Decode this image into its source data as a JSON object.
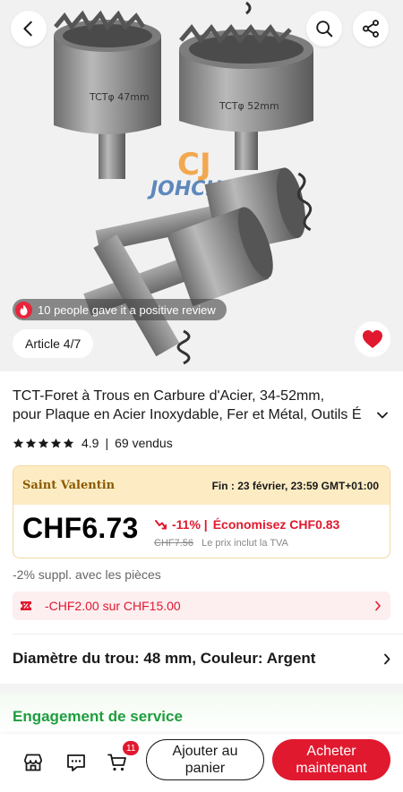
{
  "gallery": {
    "review_badge": "10 people gave it a positive review",
    "article_counter": "Article 4/7",
    "brand_watermark": "JOHCH",
    "engraving_left": "TCTφ 47mm",
    "engraving_right": "TCTφ 52mm"
  },
  "product": {
    "title_line1": "TCT-Foret à Trous en Carbure d'Acier, 34-52mm,",
    "title_line2": "pour Plaque en Acier Inoxydable, Fer et Métal, Outils É",
    "rating": "4.9",
    "sold": "69 vendus",
    "stars_filled": 5
  },
  "promo": {
    "name": "Saint Valentin",
    "ends": "Fin :  23 février, 23:59 GMT+01:00",
    "price": "CHF6.73",
    "discount": "-11% |",
    "savings": "Économisez CHF0.83",
    "old_price": "CHF7.56",
    "vat_note": "Le prix inclut la TVA"
  },
  "extra_note": "-2% suppl. avec les pièces",
  "coupon": {
    "text": "-CHF2.00 sur CHF15.00"
  },
  "spec": {
    "text": "Diamètre du trou: 48 mm, Couleur: Argent"
  },
  "service": {
    "title": "Engagement de service"
  },
  "bottom_bar": {
    "cart_count": "11",
    "add_to_cart_line1": "Ajouter au",
    "add_to_cart_line2": "panier",
    "buy_now_line1": "Acheter",
    "buy_now_line2": "maintenant"
  },
  "colors": {
    "accent": "#e0192f",
    "promo_header": "#fdecc3",
    "service_green": "#1e9e3e"
  }
}
